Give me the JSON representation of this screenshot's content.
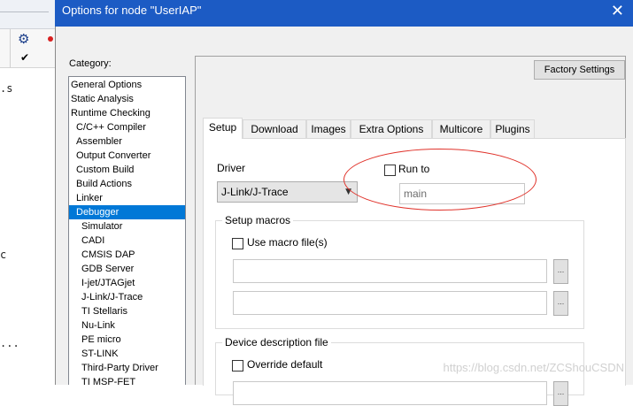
{
  "background_editor": {
    "code_fragments": [
      ".s",
      "c",
      "..."
    ],
    "icons": [
      "gear-icon",
      "breakpoint-dot-icon",
      "checkmark-icon"
    ]
  },
  "dialog": {
    "title": "Options for node \"UserIAP\"",
    "close_glyph": "✕",
    "category_label": "Category:",
    "categories": [
      {
        "label": "General Options",
        "selected": false
      },
      {
        "label": "Static Analysis",
        "selected": false
      },
      {
        "label": "Runtime Checking",
        "selected": false
      },
      {
        "label": "C/C++ Compiler",
        "selected": false
      },
      {
        "label": "Assembler",
        "selected": false
      },
      {
        "label": "Output Converter",
        "selected": false
      },
      {
        "label": "Custom Build",
        "selected": false
      },
      {
        "label": "Build Actions",
        "selected": false
      },
      {
        "label": "Linker",
        "selected": false
      },
      {
        "label": "Debugger",
        "selected": true
      },
      {
        "label": "Simulator",
        "selected": false
      },
      {
        "label": "CADI",
        "selected": false
      },
      {
        "label": "CMSIS DAP",
        "selected": false
      },
      {
        "label": "GDB Server",
        "selected": false
      },
      {
        "label": "I-jet/JTAGjet",
        "selected": false
      },
      {
        "label": "J-Link/J-Trace",
        "selected": false
      },
      {
        "label": "TI Stellaris",
        "selected": false
      },
      {
        "label": "Nu-Link",
        "selected": false
      },
      {
        "label": "PE micro",
        "selected": false
      },
      {
        "label": "ST-LINK",
        "selected": false
      },
      {
        "label": "Third-Party Driver",
        "selected": false
      },
      {
        "label": "TI MSP-FET",
        "selected": false
      }
    ],
    "factory_settings_label": "Factory Settings",
    "tabs": [
      {
        "label": "Setup",
        "active": true
      },
      {
        "label": "Download",
        "active": false
      },
      {
        "label": "Images",
        "active": false
      },
      {
        "label": "Extra Options",
        "active": false
      },
      {
        "label": "Multicore",
        "active": false
      },
      {
        "label": "Plugins",
        "active": false
      }
    ],
    "setup": {
      "driver_label": "Driver",
      "driver_value": "J-Link/J-Trace",
      "run_to_label": "Run to",
      "run_to_checked": false,
      "run_to_value": "main",
      "setup_macros_title": "Setup macros",
      "use_macro_files_label": "Use macro file(s)",
      "use_macro_files_checked": false,
      "macro_file_1": "",
      "macro_file_2": "",
      "browse_label": "...",
      "device_description_title": "Device description file",
      "override_default_label": "Override default",
      "override_default_checked": false
    },
    "annotation_color": "#e0322a",
    "accent_color": "#1c5bc4",
    "selection_color": "#0078d7"
  },
  "watermark": "https://blog.csdn.net/ZCShouCSDN"
}
